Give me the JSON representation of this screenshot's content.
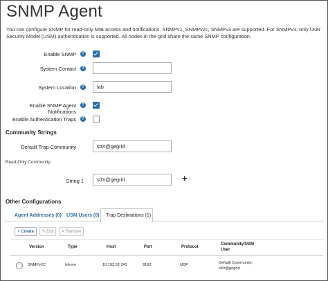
{
  "page": {
    "title": "SNMP Agent",
    "description": "You can configure SNMP for read-only MIB access and notifications. SNMPv1, SNMPv2c, SNMPv3 are supported. For SNMPv3, only User Security Model (USM) authentication is supported. All nodes in the grid share the same SNMP configuration."
  },
  "form": {
    "enable_snmp": {
      "label": "Enable SNMP",
      "checked": true
    },
    "system_contact": {
      "label": "System Contact",
      "value": ""
    },
    "system_location": {
      "label": "System Location",
      "value": "lab"
    },
    "enable_notifications": {
      "label": "Enable SNMP Agent Notifications",
      "checked": true
    },
    "enable_auth_traps": {
      "label": "Enable Authentication Traps",
      "checked": false
    },
    "help_glyph": "?"
  },
  "community": {
    "heading": "Community Strings",
    "default_trap_label": "Default Trap Community",
    "default_trap_value": "st0r@gegrid",
    "read_only_label": "Read-Only Community",
    "string1_label": "String 1",
    "string1_value": "st0r@gegrid",
    "add_glyph": "+"
  },
  "other": {
    "heading": "Other Configurations",
    "tabs": [
      {
        "label": "Agent Addresses (0)",
        "active": false
      },
      {
        "label": "USM Users (0)",
        "active": false
      },
      {
        "label": "Trap Destinations (1)",
        "active": true
      }
    ],
    "toolbar": {
      "create": "+ Create",
      "edit": "✎ Edit",
      "remove": "✕ Remove"
    },
    "table": {
      "headers": [
        "Version",
        "Type",
        "Host",
        "Port",
        "Protocol",
        "Community/USM User"
      ],
      "rows": [
        {
          "version": "SNMPv2C",
          "type": "Inform",
          "host": "10.193.92.241",
          "port": "9162",
          "protocol": "UDP",
          "community": "Default Community: st0r@gegrid"
        }
      ]
    }
  },
  "colors": {
    "accent": "#2e6da4"
  }
}
